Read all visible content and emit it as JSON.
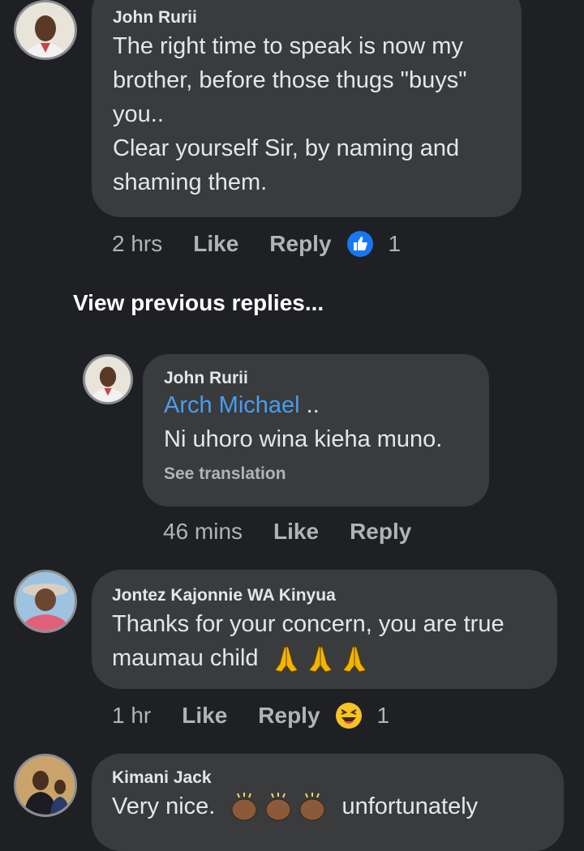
{
  "comments": [
    {
      "author": "John Rurii",
      "lines": [
        "The right time to speak is now my",
        "brother, before those thugs \"buys\"",
        "you..",
        "Clear yourself Sir, by naming and",
        "shaming them."
      ],
      "time": "2 hrs",
      "like_label": "Like",
      "reply_label": "Reply",
      "reaction_count": "1"
    },
    {
      "author": "John Rurii",
      "mention": "Arch Michael",
      "mention_suffix": " ..",
      "text": "Ni uhoro wina kieha muno.",
      "see_translation": "See translation",
      "time": "46 mins",
      "like_label": "Like",
      "reply_label": "Reply"
    },
    {
      "author": "Jontez Kajonnie WA Kinyua",
      "lines": [
        "Thanks for your concern, you are true",
        "maumau child"
      ],
      "time": "1 hr",
      "like_label": "Like",
      "reply_label": "Reply",
      "reaction_count": "1"
    },
    {
      "author": "Kimani Jack",
      "text_before": "Very nice.",
      "text_after": "unfortunately"
    }
  ],
  "view_previous_replies": "View previous replies...",
  "icons": {
    "like_reaction": "thumbs-up-icon",
    "haha_reaction": "laughing-face-icon",
    "pray": "folded-hands-icon",
    "clap": "clapping-hands-icon"
  },
  "colors": {
    "background": "#1f2023",
    "bubble": "#3a3b3c",
    "mention": "#4a9cf0",
    "like_blue": "#1877f2"
  }
}
